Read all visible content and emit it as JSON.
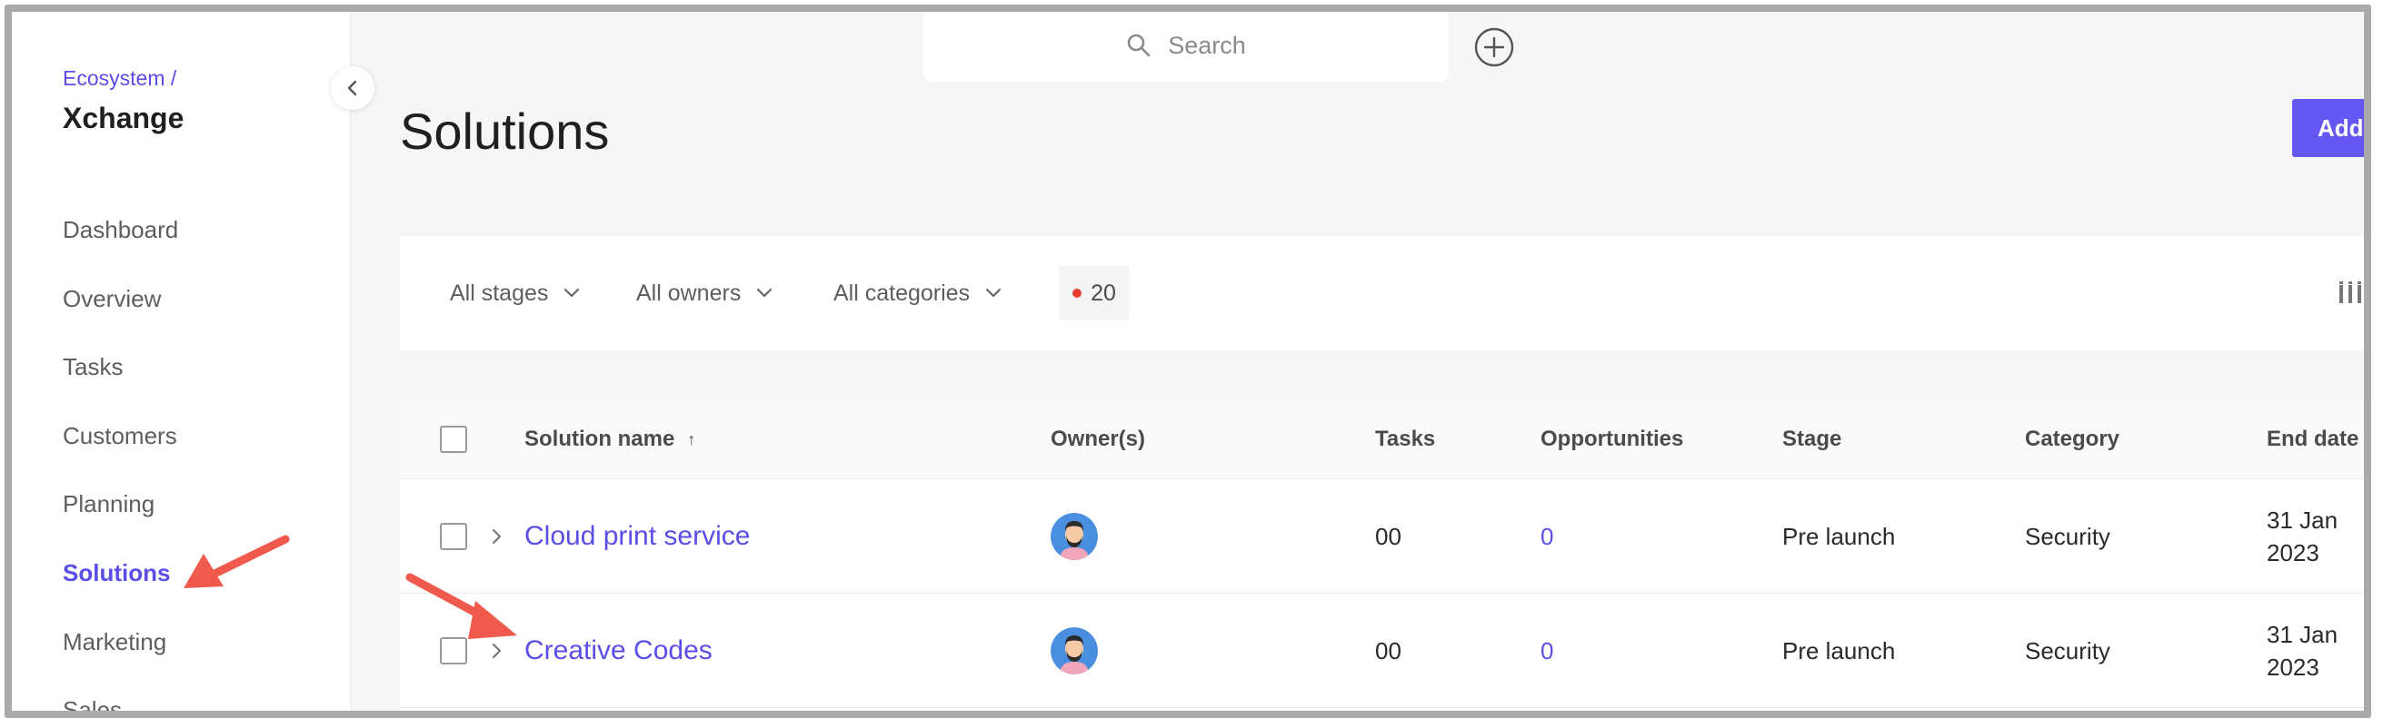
{
  "sidebar": {
    "breadcrumb": "Ecosystem /",
    "app_name": "Xchange",
    "items": [
      {
        "label": "Dashboard",
        "active": false
      },
      {
        "label": "Overview",
        "active": false
      },
      {
        "label": "Tasks",
        "active": false
      },
      {
        "label": "Customers",
        "active": false
      },
      {
        "label": "Planning",
        "active": false
      },
      {
        "label": "Solutions",
        "active": true
      },
      {
        "label": "Marketing",
        "active": false
      },
      {
        "label": "Sales",
        "active": false
      }
    ]
  },
  "search": {
    "placeholder": "Search"
  },
  "page": {
    "title": "Solutions",
    "add_label": "Add"
  },
  "filters": {
    "stages": "All stages",
    "owners": "All owners",
    "categories": "All categories",
    "count": "20"
  },
  "table": {
    "headers": {
      "name": "Solution name",
      "sort_indicator": "↑",
      "owners": "Owner(s)",
      "tasks": "Tasks",
      "opportunities": "Opportunities",
      "stage": "Stage",
      "category": "Category",
      "end_date": "End date"
    },
    "rows": [
      {
        "name": "Cloud print service",
        "tasks": "00",
        "opportunities": "0",
        "stage": "Pre launch",
        "category": "Security",
        "end_date_line1": "31 Jan",
        "end_date_line2": "2023"
      },
      {
        "name": "Creative Codes",
        "tasks": "00",
        "opportunities": "0",
        "stage": "Pre launch",
        "category": "Security",
        "end_date_line1": "31 Jan",
        "end_date_line2": "2023"
      }
    ]
  },
  "colors": {
    "accent": "#5b4ee6",
    "button": "#6457f2",
    "annotation_arrow": "#ef5a4c",
    "filter_dot": "#e5402f"
  }
}
